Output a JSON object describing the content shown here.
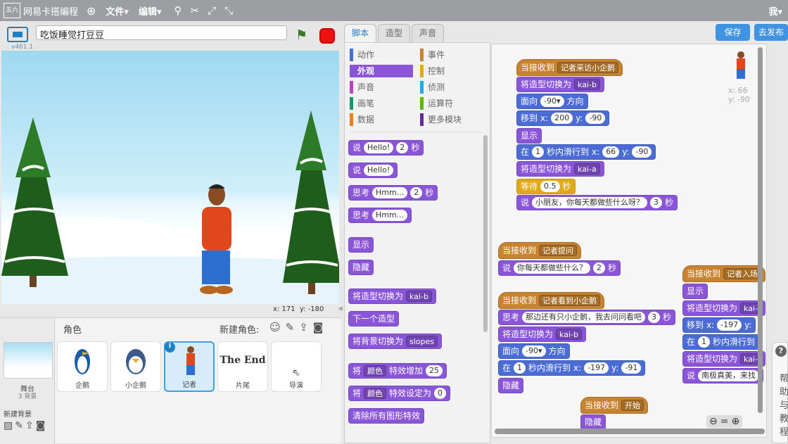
{
  "app": {
    "logo_icon_text": "五六",
    "title": "网易卡搭编程",
    "menu_file": "文件▾",
    "menu_edit": "编辑▾",
    "user": "我▾"
  },
  "toolbar_icons": [
    "copy-icon",
    "cut-icon",
    "grow-icon",
    "shrink-icon"
  ],
  "stage": {
    "version": "v461.1",
    "project_title": "吃饭睡觉打豆豆",
    "coords_x_label": "x:",
    "coords_x": "171",
    "coords_y_label": "y:",
    "coords_y": "-180"
  },
  "sprites_panel": {
    "header": "角色",
    "new_sprite_label": "新建角色:",
    "stage_label": "舞台",
    "stage_count": "3 背景",
    "new_backdrop_label": "新建背景",
    "sprites": [
      {
        "name": "企鹅"
      },
      {
        "name": "小企鹅"
      },
      {
        "name": "记者",
        "selected": true
      },
      {
        "name": "片尾",
        "thumb_text": "The End"
      },
      {
        "name": "导演"
      }
    ]
  },
  "editor": {
    "tabs": [
      "脚本",
      "造型",
      "声音"
    ],
    "save": "保存",
    "share": "去发布"
  },
  "palette": {
    "categories": [
      {
        "label": "动作",
        "color": "#4a6cd4"
      },
      {
        "label": "事件",
        "color": "#c88330"
      },
      {
        "label": "外观",
        "color": "#8a55d7",
        "active": true
      },
      {
        "label": "控制",
        "color": "#e1a91a"
      },
      {
        "label": "声音",
        "color": "#bb42c3"
      },
      {
        "label": "侦测",
        "color": "#2ca5e2"
      },
      {
        "label": "画笔",
        "color": "#0e9a6c"
      },
      {
        "label": "运算符",
        "color": "#5cb712"
      },
      {
        "label": "数据",
        "color": "#ee7d16"
      },
      {
        "label": "更多模块",
        "color": "#632d99"
      }
    ],
    "blocks": {
      "say_secs": {
        "say": "说",
        "hello": "Hello!",
        "secs": "2",
        "sec_unit": "秒"
      },
      "say": {
        "say": "说",
        "hello": "Hello!"
      },
      "think_secs": {
        "think": "思考",
        "hmm": "Hmm...",
        "secs": "2",
        "sec_unit": "秒"
      },
      "think": {
        "think": "思考",
        "hmm": "Hmm..."
      },
      "show": "显示",
      "hide": "隐藏",
      "switch_costume": {
        "label": "将造型切换为",
        "value": "kai-b"
      },
      "next_costume": "下一个造型",
      "switch_backdrop": {
        "label": "将背景切换为",
        "value": "slopes"
      },
      "change_effect": {
        "pre": "将",
        "effect": "颜色",
        "mid": "特效增加",
        "value": "25"
      },
      "set_effect": {
        "pre": "将",
        "effect": "颜色",
        "mid": "特效设定为",
        "value": "0"
      },
      "clear_effects": "清除所有图形特效"
    }
  },
  "scripts": {
    "s1": {
      "hat": "当接收到",
      "msg": "记者采访小企鹅",
      "costume_label": "将造型切换为",
      "costume1": "kai-b",
      "face": "面向",
      "dir": "-90▾",
      "dir_unit": "方向",
      "goto": "移到",
      "x_lbl": "x:",
      "x": "200",
      "y_lbl": "y:",
      "y": "-90",
      "show": "显示",
      "glide_pre": "在",
      "glide_secs": "1",
      "glide_mid": "秒内滑行到",
      "gx": "66",
      "gy": "-90",
      "costume2": "kai-a",
      "wait": "等待",
      "wait_secs": "0.5",
      "sec_unit": "秒",
      "say": "说",
      "say_text": "小朋友，你每天都做些什么呀？",
      "say_secs": "3"
    },
    "s2": {
      "hat": "当接收到",
      "msg": "记者提问",
      "say": "说",
      "say_text": "你每天都做些什么？",
      "say_secs": "2",
      "sec_unit": "秒"
    },
    "s3": {
      "hat": "当接收到",
      "msg": "记者看到小企鹅",
      "think": "思考",
      "think_text": "那边还有只小企鹅，我去问问看吧",
      "think_secs": "3",
      "sec_unit": "秒",
      "costume_label": "将造型切换为",
      "costume": "kai-b",
      "face": "面向",
      "dir": "-90▾",
      "dir_unit": "方向",
      "glide_pre": "在",
      "glide_secs": "1",
      "glide_mid": "秒内滑行到",
      "x_lbl": "x:",
      "gx": "-197",
      "y_lbl": "y:",
      "gy": "-91",
      "hide": "隐藏"
    },
    "s4": {
      "hat": "当接收到",
      "msg": "开始",
      "hide": "隐藏"
    },
    "s5": {
      "hat": "当接收到",
      "msg": "记者入场",
      "show": "显示",
      "costume_label": "将造型切换为",
      "costume": "kai-",
      "goto": "移到",
      "x_lbl": "x:",
      "x": "-197",
      "y_lbl": "y:",
      "glide_pre": "在",
      "glide_secs": "1",
      "glide_mid": "秒内滑行到",
      "costume2": "kai-",
      "say": "说",
      "say_text": "南极真美，来找"
    }
  },
  "sprite_info": {
    "x_label": "x:",
    "x": "66",
    "y_label": "y:",
    "y": "-90"
  },
  "help": {
    "label": "帮助与教程"
  }
}
